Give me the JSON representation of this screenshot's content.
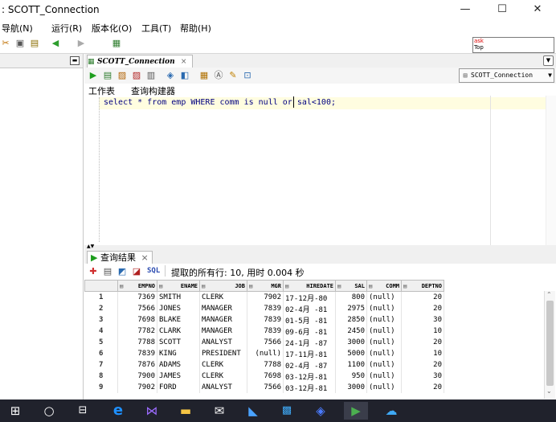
{
  "window": {
    "title": ": SCOTT_Connection",
    "min_glyph": "—",
    "max_glyph": "☐",
    "close_glyph": "✕"
  },
  "menu": {
    "items": [
      "导航(N)",
      "运行(R)",
      "版本化(O)",
      "工具(T)",
      "帮助(H)"
    ]
  },
  "search": {
    "value": "ask Top",
    "line1": "ask",
    "line2": "Top"
  },
  "editor": {
    "tab_label": "SCOTT_Connection",
    "tab_close": "×",
    "connection": "SCOTT_Connection",
    "subtabs": [
      "工作表",
      "查询构建器"
    ],
    "sql_before": "select * from emp WHERE comm is null or",
    "sql_after": " sal<100;"
  },
  "results": {
    "tab_label": "查询结果",
    "tab_close": "×",
    "sql_button": "SQL",
    "status": "提取的所有行: 10, 用时 0.004 秒",
    "columns": [
      "EMPNO",
      "ENAME",
      "JOB",
      "MGR",
      "HIREDATE",
      "SAL",
      "COMM",
      "DEPTNO"
    ],
    "rows": [
      [
        "1",
        "7369",
        "SMITH",
        "CLERK",
        "7902",
        "17-12月-80",
        "800",
        "(null)",
        "20"
      ],
      [
        "2",
        "7566",
        "JONES",
        "MANAGER",
        "7839",
        "02-4月 -81",
        "2975",
        "(null)",
        "20"
      ],
      [
        "3",
        "7698",
        "BLAKE",
        "MANAGER",
        "7839",
        "01-5月 -81",
        "2850",
        "(null)",
        "30"
      ],
      [
        "4",
        "7782",
        "CLARK",
        "MANAGER",
        "7839",
        "09-6月 -81",
        "2450",
        "(null)",
        "10"
      ],
      [
        "5",
        "7788",
        "SCOTT",
        "ANALYST",
        "7566",
        "24-1月 -87",
        "3000",
        "(null)",
        "20"
      ],
      [
        "6",
        "7839",
        "KING",
        "PRESIDENT",
        "(null)",
        "17-11月-81",
        "5000",
        "(null)",
        "10"
      ],
      [
        "7",
        "7876",
        "ADAMS",
        "CLERK",
        "7788",
        "02-4月 -87",
        "1100",
        "(null)",
        "20"
      ],
      [
        "8",
        "7900",
        "JAMES",
        "CLERK",
        "7698",
        "03-12月-81",
        "950",
        "(null)",
        "30"
      ],
      [
        "9",
        "7902",
        "FORD",
        "ANALYST",
        "7566",
        "03-12月-81",
        "3000",
        "(null)",
        "20"
      ]
    ]
  },
  "colors": {
    "accent": "#1e90ff",
    "taskbar": "#20222c",
    "editor_line": "#fffde0",
    "sql_text": "#000080"
  },
  "taskbar": {
    "icons": [
      "windows-start-icon",
      "cortana-circle-icon",
      "task-view-icon",
      "edge-icon",
      "visual-studio-icon",
      "file-explorer-icon",
      "mail-icon",
      "feedback-icon",
      "app-icon",
      "browser-icon",
      "sqldeveloper-icon",
      "cloud-icon"
    ]
  }
}
